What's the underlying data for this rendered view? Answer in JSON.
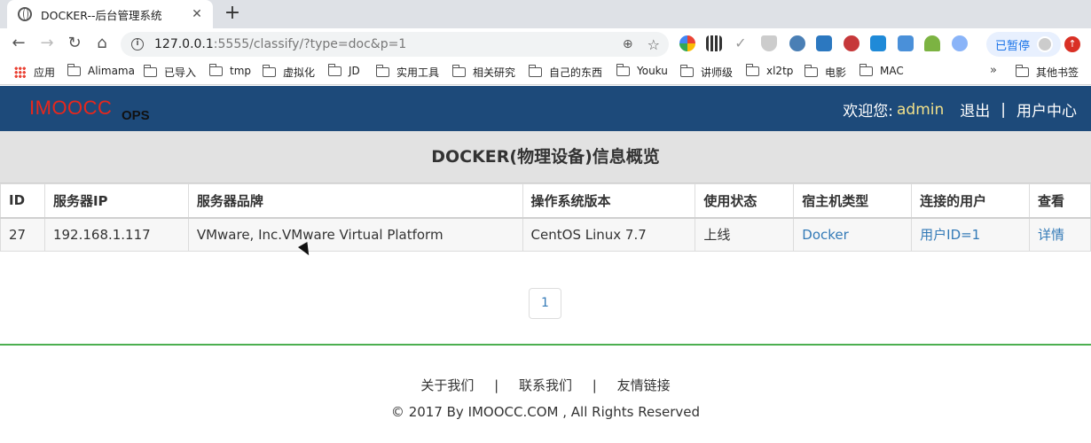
{
  "browser": {
    "tab_title": "DOCKER--后台管理系统",
    "url_host": "127.0.0.1",
    "url_rest": ":5555/classify/?type=doc&p=1",
    "paused_label": "已暂停",
    "bookmarks": [
      "应用",
      "Alimama",
      "已导入",
      "tmp",
      "虚拟化",
      "JD",
      "实用工具",
      "相关研究",
      "自己的东西",
      "Youku",
      "讲师级",
      "xl2tp",
      "电影",
      "MAC"
    ],
    "more_bookmarks": "其他书签"
  },
  "header": {
    "logo": "IMOOCC",
    "logo_sub": "OPS",
    "welcome": "欢迎您:",
    "username": "admin",
    "logout": "退出",
    "separator": "|",
    "user_center": "用户中心"
  },
  "panel": {
    "title": "DOCKER(物理设备)信息概览"
  },
  "table": {
    "headers": [
      "ID",
      "服务器IP",
      "服务器品牌",
      "操作系统版本",
      "使用状态",
      "宿主机类型",
      "连接的用户",
      "查看"
    ],
    "rows": [
      {
        "id": "27",
        "ip": "192.168.1.117",
        "brand": "VMware, Inc.VMware Virtual Platform",
        "os": "CentOS Linux 7.7",
        "status": "上线",
        "host_type": "Docker",
        "user": "用户ID=1",
        "view": "详情"
      }
    ]
  },
  "pagination": {
    "current_page": "1"
  },
  "footer": {
    "about": "关于我们",
    "contact": "联系我们",
    "links": "友情链接",
    "separator": "|",
    "copyright": "© 2017 By IMOOCC.COM , All Rights Reserved"
  },
  "colors": {
    "header_bg": "#1d4a7a",
    "logo": "#e8271c",
    "username": "#f2e18a",
    "link": "#337ab7",
    "rule": "#4caf50"
  },
  "icons": [
    "globe-icon",
    "close-icon",
    "plus-icon",
    "back-icon",
    "forward-icon",
    "reload-icon",
    "home-icon",
    "info-icon",
    "zoom-icon",
    "star-icon",
    "apps-icon",
    "folder-icon",
    "cursor-icon"
  ]
}
